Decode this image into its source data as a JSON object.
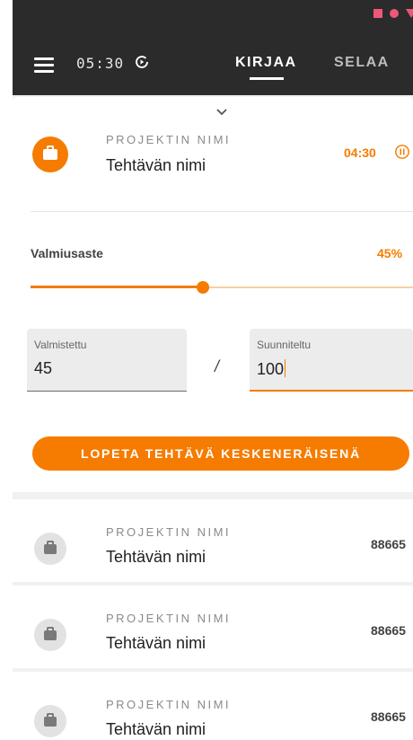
{
  "statusbar": {
    "icons": [
      "square-icon",
      "circle-icon",
      "triangle-icon"
    ],
    "color": "#f0557a"
  },
  "header": {
    "timer": "05:30",
    "timer_icon": "play-circle-icon",
    "tabs": [
      {
        "label": "KIRJAA",
        "active": true
      },
      {
        "label": "SELAA",
        "active": false
      }
    ]
  },
  "active_task": {
    "project_label": "PROJEKTIN NIMI",
    "task_name": "Tehtävän nimi",
    "elapsed": "04:30",
    "pause_icon": "pause-circle-icon",
    "progress_label": "Valmiusaste",
    "progress_value": "45%",
    "progress_fraction": 0.45,
    "done_label": "Valmistettu",
    "done_value": "45",
    "separator": "/",
    "planned_label": "Suunniteltu",
    "planned_value": "100",
    "finish_button": "LOPETA TEHTÄVÄ KESKENERÄISENÄ"
  },
  "task_list": [
    {
      "project": "PROJEKTIN NIMI",
      "task": "Tehtävän nimi",
      "number": "88665"
    },
    {
      "project": "PROJEKTIN NIMI",
      "task": "Tehtävän nimi",
      "number": "88665"
    },
    {
      "project": "PROJEKTIN NIMI",
      "task": "Tehtävän nimi",
      "number": "88665"
    }
  ],
  "colors": {
    "accent": "#f57c00",
    "appbar": "#2b2b2b"
  }
}
